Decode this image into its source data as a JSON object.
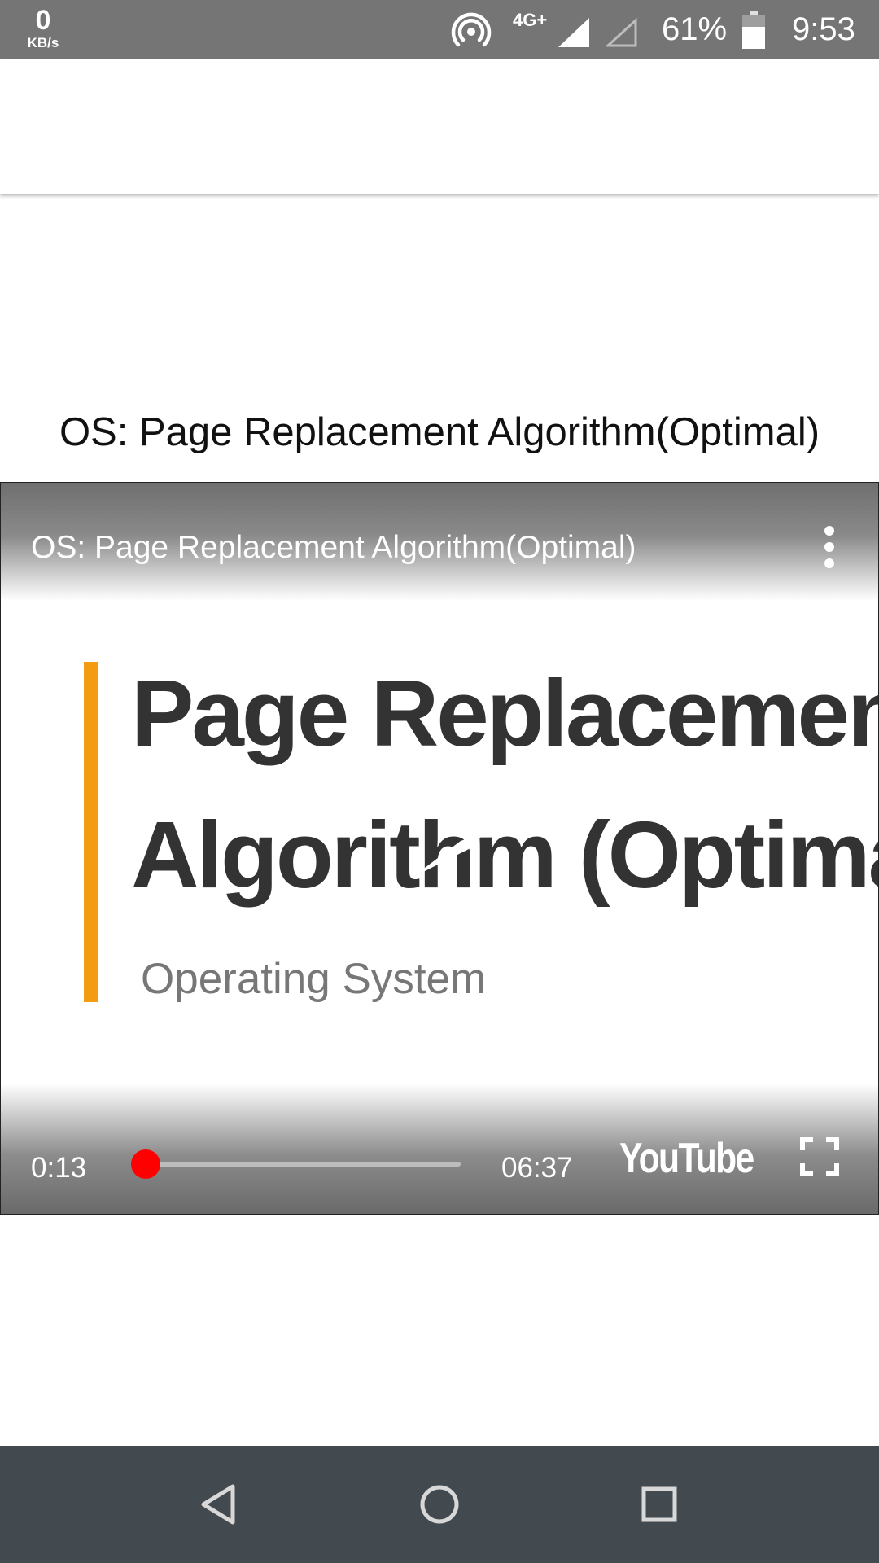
{
  "status_bar": {
    "speed_value": "0",
    "speed_unit": "KB/s",
    "network": "4G+",
    "battery_percent": "61%",
    "time": "9:53",
    "icons": [
      "hotspot-icon",
      "signal-icon",
      "signal-empty-icon",
      "battery-icon"
    ]
  },
  "page": {
    "title": "OS: Page Replacement Algorithm(Optimal)"
  },
  "player": {
    "title": "OS: Page Replacement Algorithm(Optimal)",
    "slide_line1": "Page Replacement",
    "slide_line2": "Algorithm (Optimal)",
    "slide_subtitle": "Operating System",
    "current_time": "0:13",
    "total_time": "06:37",
    "progress_fraction": 0.033,
    "logo_text": "YouTube",
    "accent_color": "#ff0000",
    "slide_accent_color": "#f39c12"
  },
  "nav_bar": {
    "icons": [
      "back-icon",
      "home-icon",
      "recents-icon"
    ]
  }
}
